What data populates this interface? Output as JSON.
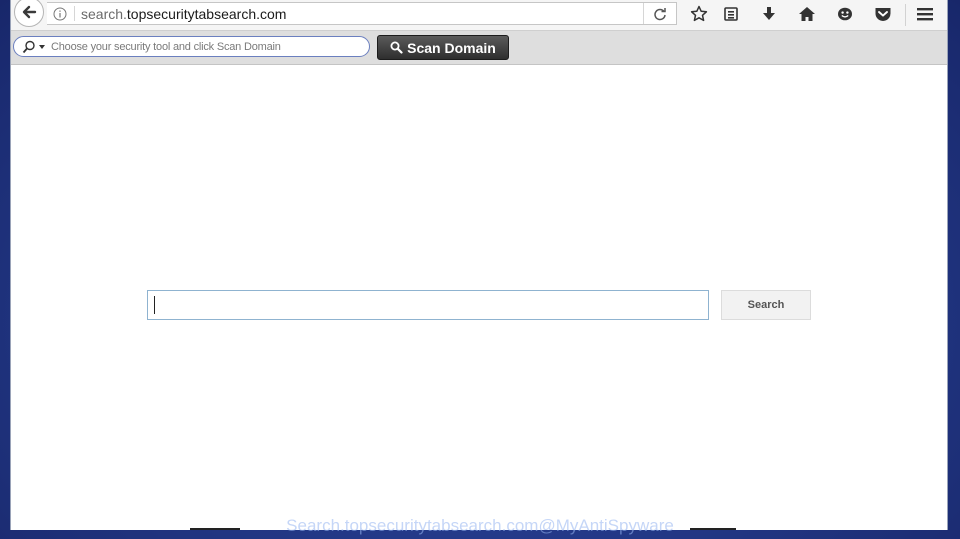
{
  "browser": {
    "url_prefix": "search.",
    "url_domain": "topsecuritytabsearch.com"
  },
  "addon_toolbar": {
    "tool_placeholder": "Choose your security tool and click Scan Domain",
    "scan_button_label": "Scan Domain"
  },
  "page": {
    "search_value": "",
    "search_button_label": "Search"
  },
  "watermark": "Search.topsecuritytabsearch.com@MyAntiSpyware",
  "colors": {
    "desktop_bg": "#243a8a",
    "scan_button_bg": "#3a3a3a",
    "input_border": "#8fb3d0"
  }
}
